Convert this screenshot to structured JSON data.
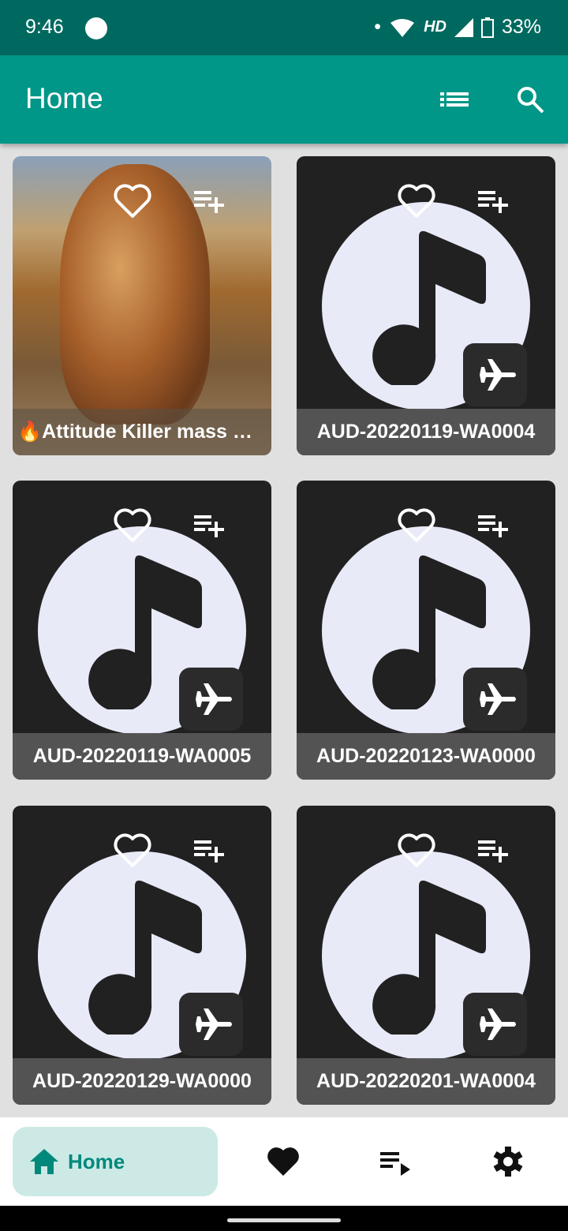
{
  "status": {
    "time": "9:46",
    "network": "HD",
    "battery": "33%"
  },
  "appbar": {
    "title": "Home"
  },
  "songs": [
    {
      "title": "🔥Attitude Killer mass …",
      "has_artwork": true
    },
    {
      "title": "AUD-20220119-WA0004"
    },
    {
      "title": "AUD-20220119-WA0005"
    },
    {
      "title": "AUD-20220123-WA0000"
    },
    {
      "title": "AUD-20220129-WA0000"
    },
    {
      "title": "AUD-20220201-WA0004"
    }
  ],
  "bottom_nav": {
    "home_label": "Home"
  },
  "colors": {
    "primary": "#009688",
    "status": "#00695f",
    "pill": "#cce9e6"
  }
}
